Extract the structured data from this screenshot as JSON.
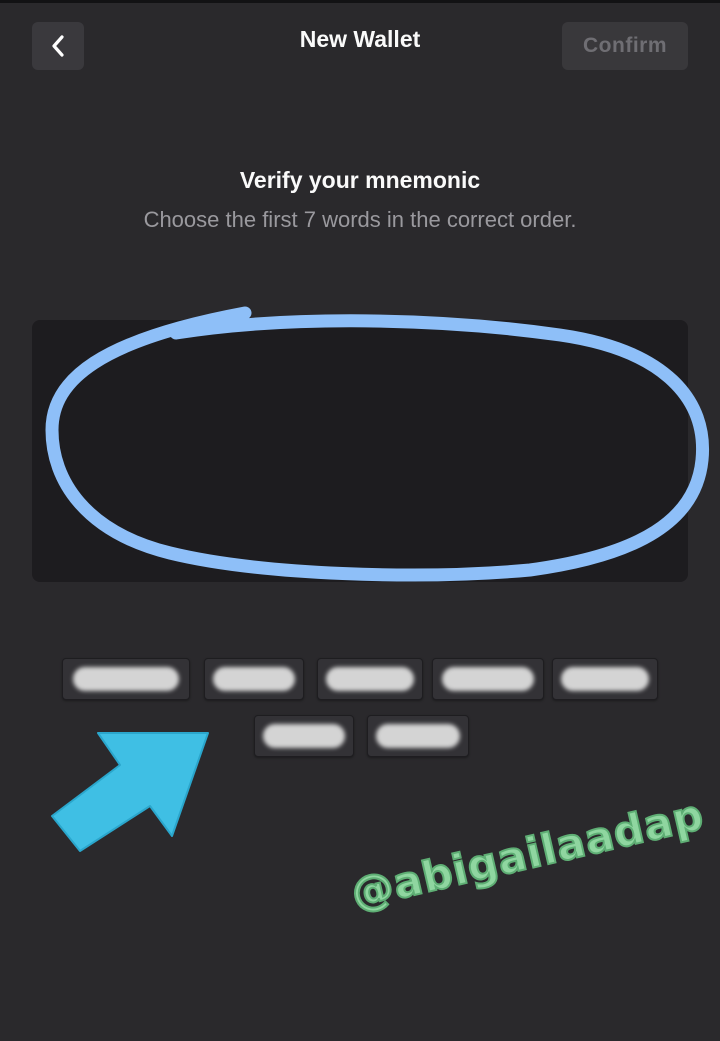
{
  "header": {
    "title": "New Wallet",
    "confirm_label": "Confirm"
  },
  "verify": {
    "title": "Verify your mnemonic",
    "subtitle": "Choose the first 7 words in the correct order."
  },
  "word_chips": {
    "count": 7,
    "content": "obscured"
  },
  "annotations": {
    "circle_color": "#8ebff8",
    "arrow_color": "#3fbfe4",
    "watermark": "@abigailaadap"
  },
  "colors": {
    "background": "#2a292c",
    "box": "#1d1c1f",
    "button_bg": "#39383b",
    "confirm_disabled_text": "#6f6e73"
  }
}
